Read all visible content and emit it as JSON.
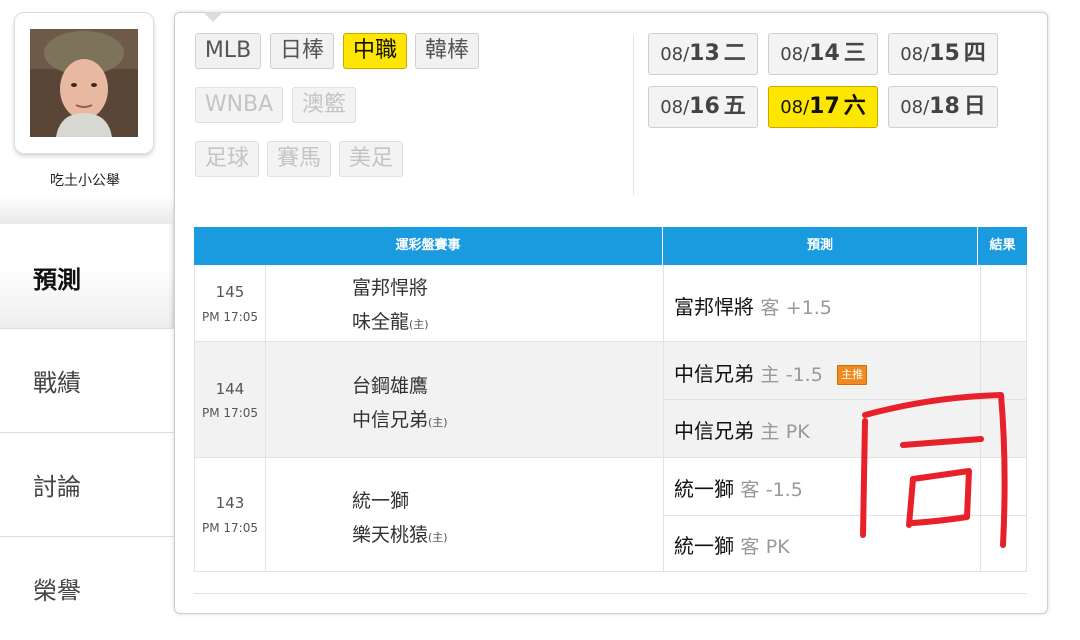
{
  "profile": {
    "username": "吃土小公舉"
  },
  "nav": {
    "items": [
      {
        "label": "預測",
        "active": true
      },
      {
        "label": "戰績",
        "active": false
      },
      {
        "label": "討論",
        "active": false
      },
      {
        "label": "榮譽",
        "active": false
      }
    ]
  },
  "categories": {
    "row1": [
      "MLB",
      "日棒",
      "中職",
      "韓棒"
    ],
    "row2": [
      "WNBA",
      "澳籃"
    ],
    "row3": [
      "足球",
      "賽馬",
      "美足"
    ],
    "active": "中職"
  },
  "dates": [
    {
      "month": "08/",
      "day": "13",
      "weekday": "二",
      "active": false
    },
    {
      "month": "08/",
      "day": "14",
      "weekday": "三",
      "active": false
    },
    {
      "month": "08/",
      "day": "15",
      "weekday": "四",
      "active": false
    },
    {
      "month": "08/",
      "day": "16",
      "weekday": "五",
      "active": false
    },
    {
      "month": "08/",
      "day": "17",
      "weekday": "六",
      "active": true
    },
    {
      "month": "08/",
      "day": "18",
      "weekday": "日",
      "active": false
    }
  ],
  "table": {
    "headers": {
      "event": "運彩盤賽事",
      "prediction": "預測",
      "result": "結果"
    },
    "home_mark": "(主)",
    "games": [
      {
        "no": "145",
        "time": "PM 17:05",
        "away": "富邦悍將",
        "home": "味全龍",
        "picks": [
          {
            "team": "富邦悍將",
            "side": "客",
            "line": "+1.5"
          }
        ]
      },
      {
        "no": "144",
        "time": "PM 17:05",
        "away": "台鋼雄鷹",
        "home": "中信兄弟",
        "picks": [
          {
            "team": "中信兄弟",
            "side": "主",
            "line": "-1.5",
            "badge": "主推"
          },
          {
            "team": "中信兄弟",
            "side": "主",
            "line": "PK"
          }
        ]
      },
      {
        "no": "143",
        "time": "PM 17:05",
        "away": "統一獅",
        "home": "樂天桃猿",
        "picks": [
          {
            "team": "統一獅",
            "side": "客",
            "line": "-1.5"
          },
          {
            "team": "統一獅",
            "side": "客",
            "line": "PK"
          }
        ]
      }
    ]
  },
  "annotation": {
    "text": "同",
    "color": "#e8202a"
  },
  "colors": {
    "accent_yellow": "#ffe600",
    "header_blue": "#1a9be0",
    "badge_orange": "#f08a1e"
  }
}
